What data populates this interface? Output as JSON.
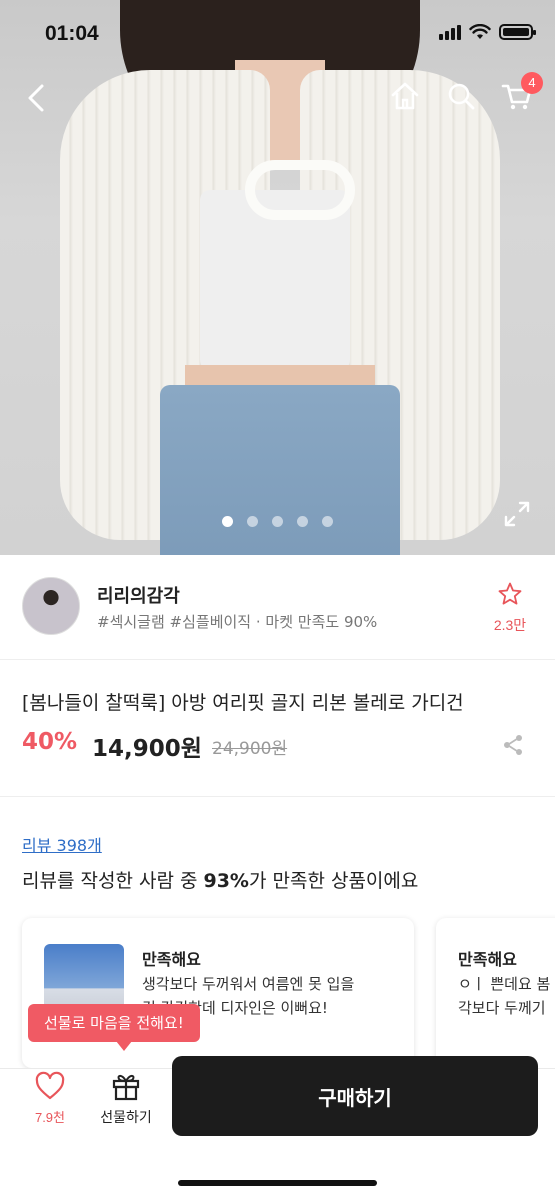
{
  "status_bar": {
    "time": "01:04"
  },
  "nav": {
    "cart_count": "4",
    "icons": [
      "back-icon",
      "home-icon",
      "search-icon",
      "cart-icon"
    ]
  },
  "gallery": {
    "slide_count": 5,
    "active_index": 0
  },
  "seller": {
    "name": "리리의감각",
    "tags": "#섹시글램 #심플베이직 · 마켓 만족도 90%",
    "favorite_count": "2.3만"
  },
  "product": {
    "title": "[봄나들이 찰떡룩] 아방 여리핏 골지 리본 볼레로 가디건",
    "discount": "40%",
    "price": "14,900원",
    "original_price": "24,900원"
  },
  "reviews": {
    "link_label": "리뷰 398개",
    "summary_prefix": "리뷰를 작성한 사람 중 ",
    "summary_percent": "93%",
    "summary_suffix": "가 만족한 상품이에요",
    "cards": [
      {
        "title": "만족해요",
        "line1": "생각보다 두꺼워서 여름엔 못 입을",
        "line2": "것 같긴한데 디자인은 이뻐요!"
      },
      {
        "title": "만족해요",
        "line1": "ㅇㅣ 쁜데요 봄",
        "line2": "각보다 두께기"
      }
    ]
  },
  "bottom_bar": {
    "like_count": "7.9천",
    "gift_label": "선물하기",
    "buy_label": "구매하기",
    "tooltip": "선물로 마음을 전해요!"
  },
  "colors": {
    "accent": "#ef5a64",
    "link": "#2f6ec7",
    "buy_button": "#1c1c1c"
  }
}
